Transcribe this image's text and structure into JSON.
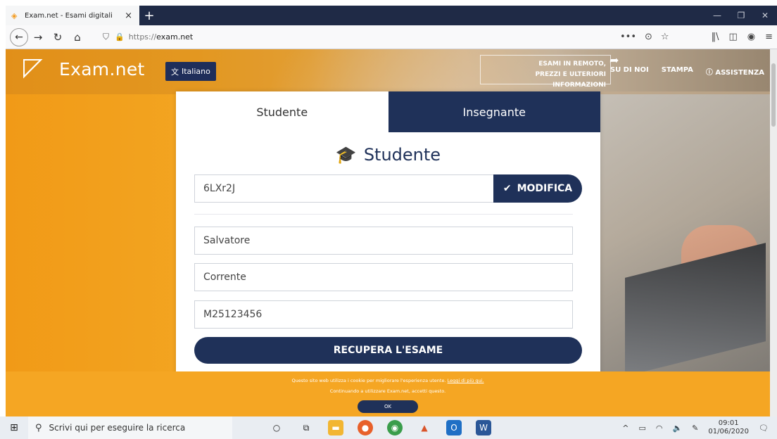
{
  "browser": {
    "tab_title": "Exam.net - Esami digitali",
    "tab_close": "×",
    "new_tab": "+",
    "url_prefix": "https://",
    "url_host": "exam.net",
    "window_min": "—",
    "window_restore": "❐",
    "window_close": "✕"
  },
  "header": {
    "logo": "Exam.net",
    "language_label": "Italiano",
    "remote_line1": "ESAMI IN REMOTO,",
    "remote_line2": "PREZZI E ULTERIORI INFORMAZIONI",
    "nav": [
      "SU DI NOI",
      "STAMPA",
      "ⓘ ASSISTENZA"
    ]
  },
  "login": {
    "tabs": [
      "Studente",
      "Insegnante"
    ],
    "active_tab": "Studente",
    "title": "Studente",
    "exam_code": "6LXr2J",
    "modify_label": "MODIFICA",
    "first_name": "Salvatore",
    "last_name": "Corrente",
    "student_id": "M25123456",
    "submit_label": "RECUPERA L'ESAME"
  },
  "cookie": {
    "text": "Questo sito web utilizza i cookie per migliorare l'esperienza utente.",
    "link": "Leggi di più qui.",
    "text2": "Continuando a utilizzare Exam.net, accetti questo.",
    "ok_label": "OK"
  },
  "taskbar": {
    "search_placeholder": "Scrivi qui per eseguire la ricerca",
    "time": "09:01",
    "date": "01/06/2020"
  },
  "colors": {
    "navy": "#1f3159",
    "orange": "#f5a623"
  }
}
